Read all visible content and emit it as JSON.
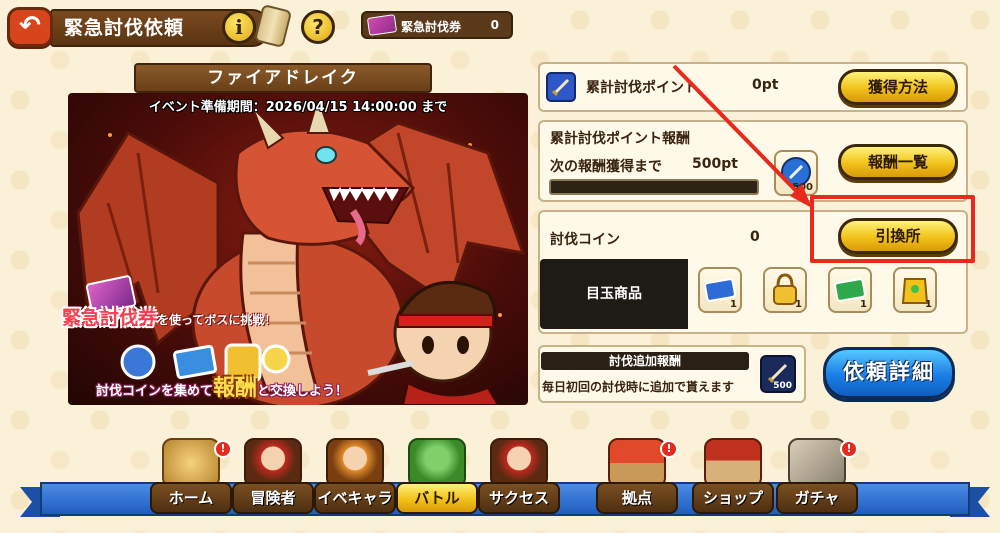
{
  "header": {
    "title": "緊急討伐依頼",
    "back_glyph": "↶",
    "info_glyph": "i",
    "help_glyph": "?",
    "ticket_label": "緊急討伐券",
    "ticket_count": "0"
  },
  "banner": {
    "boss_name": "ファイアドレイク",
    "event_period": "イベント準備期間：2026/04/15 14:00:00 まで",
    "line1_main": "緊急討伐券",
    "line1_sub": "を使ってボスに挑戦！",
    "line2_a": "討伐コインを集めて",
    "line2_big": "報酬",
    "line2_b": "と交換しよう！"
  },
  "points": {
    "label": "累計討伐ポイント",
    "value": "0pt",
    "button": "獲得方法"
  },
  "reward": {
    "title": "累計討伐ポイント報酬",
    "next_label": "次の報酬獲得まで",
    "next_value": "500pt",
    "progress": 0,
    "reward_qty": "500",
    "button": "報酬一覧"
  },
  "coins": {
    "label": "討伐コイン",
    "value": "0",
    "button": "引換所"
  },
  "featured": {
    "label": "目玉商品",
    "items": [
      {
        "icon": "blue-ticket-icon",
        "qty": "1"
      },
      {
        "icon": "golden-lock-icon",
        "qty": "1"
      },
      {
        "icon": "green-ticket-icon",
        "qty": "1"
      },
      {
        "icon": "golden-armor-icon",
        "qty": "1"
      }
    ]
  },
  "bonus": {
    "title": "討伐追加報酬",
    "desc": "毎日初回の討伐時に追加で貰えます",
    "qty": "500"
  },
  "detail_button": "依頼詳細",
  "nav": [
    {
      "label": "ホーム",
      "badge": "!",
      "active": false
    },
    {
      "label": "冒険者",
      "badge": "",
      "active": false
    },
    {
      "label": "イベキャラ",
      "badge": "",
      "active": false
    },
    {
      "label": "バトル",
      "badge": "",
      "active": true
    },
    {
      "label": "サクセス",
      "badge": "",
      "active": false
    },
    {
      "label": "拠点",
      "badge": "!",
      "active": false
    },
    {
      "label": "ショップ",
      "badge": "",
      "active": false
    },
    {
      "label": "ガチャ",
      "badge": "!",
      "active": false
    }
  ],
  "colors": {
    "accent_gold": "#f1c21a",
    "highlight_red": "#e8291c",
    "detail_blue": "#1a7ee6"
  }
}
